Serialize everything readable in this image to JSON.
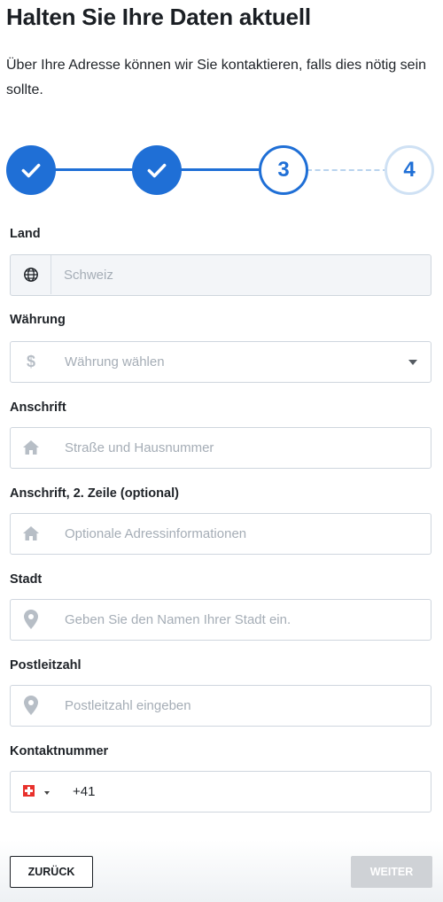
{
  "header": {
    "title": "Halten Sie Ihre Daten aktuell",
    "subtitle": "Über Ihre Adresse können wir Sie kontaktieren, falls dies nötig sein sollte."
  },
  "stepper": {
    "steps": [
      {
        "state": "complete",
        "label": ""
      },
      {
        "state": "complete",
        "label": ""
      },
      {
        "state": "current",
        "label": "3"
      },
      {
        "state": "future",
        "label": "4"
      }
    ]
  },
  "form": {
    "country": {
      "label": "Land",
      "value": "Schweiz",
      "icon": "globe-icon"
    },
    "currency": {
      "label": "Währung",
      "placeholder": "Währung wählen",
      "icon": "dollar-icon"
    },
    "address1": {
      "label": "Anschrift",
      "placeholder": "Straße und Hausnummer",
      "icon": "home-icon"
    },
    "address2": {
      "label": "Anschrift, 2. Zeile (optional)",
      "placeholder": "Optionale Adressinformationen",
      "icon": "home-icon"
    },
    "city": {
      "label": "Stadt",
      "placeholder": "Geben Sie den Namen Ihrer Stadt ein.",
      "icon": "location-pin-icon"
    },
    "postal": {
      "label": "Postleitzahl",
      "placeholder": "Postleitzahl eingeben",
      "icon": "location-pin-icon"
    },
    "phone": {
      "label": "Kontaktnummer",
      "value": "+41",
      "flag": "switzerland-flag-icon"
    }
  },
  "actions": {
    "back": "ZURÜCK",
    "next": "WEITER"
  },
  "colors": {
    "accent": "#1f6fd6",
    "disabled_button": "#cfd2d6"
  }
}
